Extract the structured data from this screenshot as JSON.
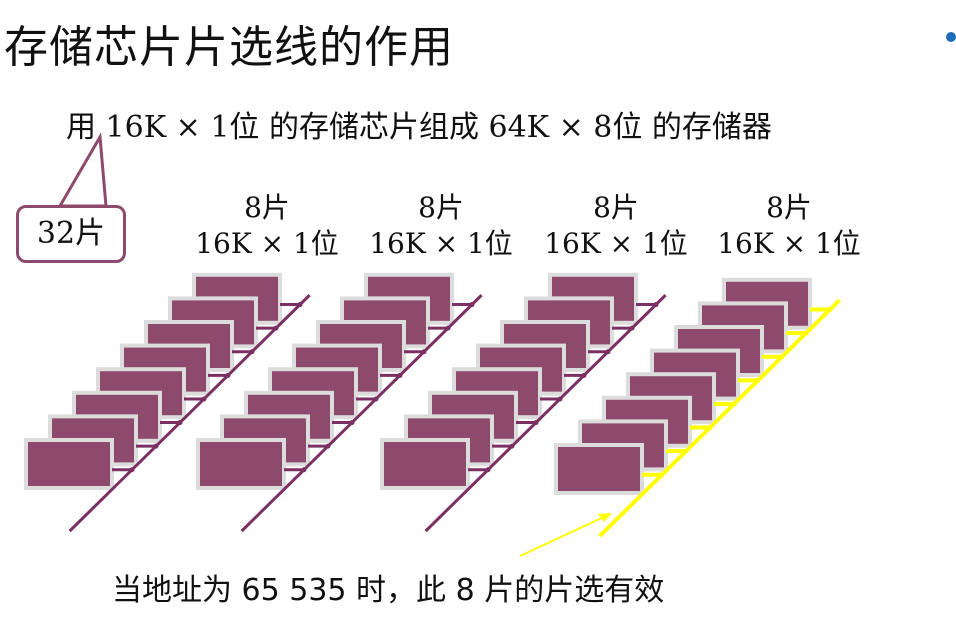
{
  "title": "存储芯片片选线的作用",
  "subtitle": "用 16K × 1位 的存储芯片组成 64K × 8位 的存储器",
  "callout": "32片",
  "groups": [
    {
      "count": "8片",
      "spec": "16K × 1位",
      "selected": false
    },
    {
      "count": "8片",
      "spec": "16K × 1位",
      "selected": false
    },
    {
      "count": "8片",
      "spec": "16K × 1位",
      "selected": false
    },
    {
      "count": "8片",
      "spec": "16K × 1位",
      "selected": true
    }
  ],
  "note": "当地址为 65 535 时，此 8 片的片选有效",
  "colors": {
    "chip_fill": "#8e4a6d",
    "chip_border": "#dcdcdc",
    "bus_normal": "#7b2f63",
    "bus_selected": "#ffff00",
    "callout_border": "#8e4a6d"
  }
}
